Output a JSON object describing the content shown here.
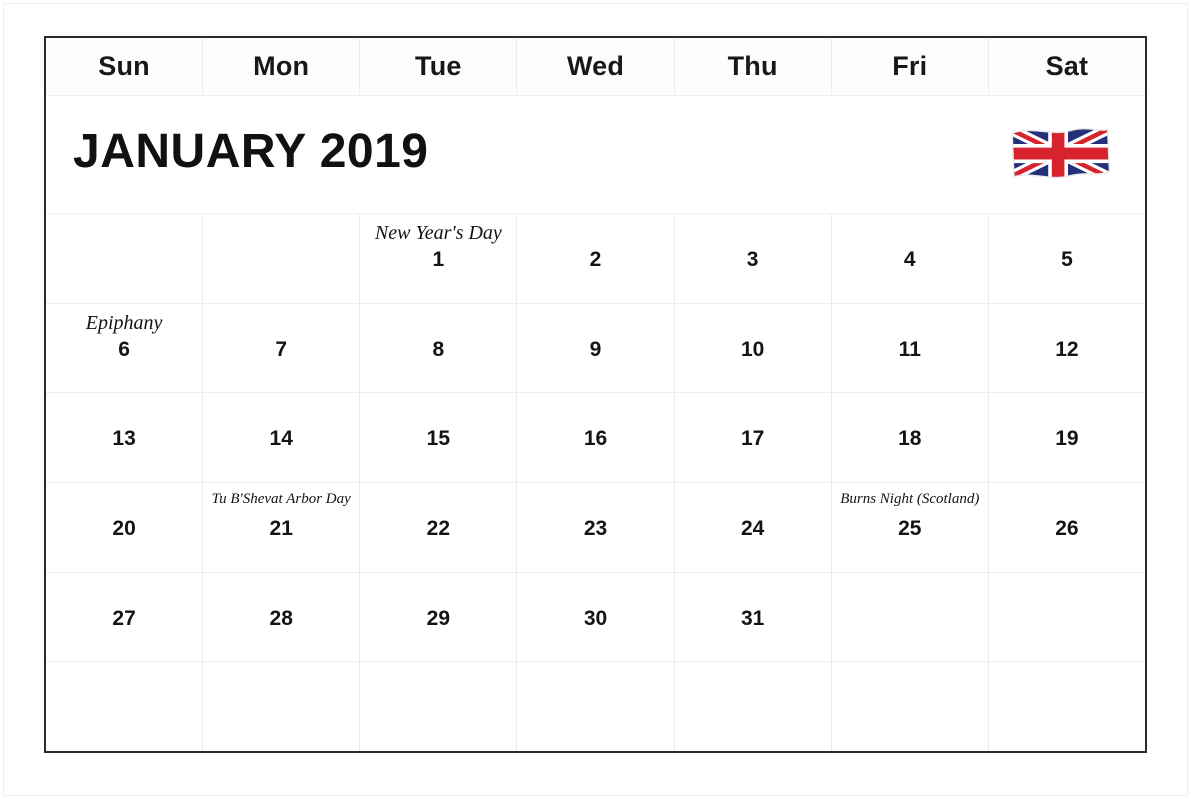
{
  "calendar": {
    "title": "JANUARY 2019",
    "flag_icon": "union-jack-flag-icon",
    "flag_label": "United Kingdom flag",
    "weekdays": [
      "Sun",
      "Mon",
      "Tue",
      "Wed",
      "Thu",
      "Fri",
      "Sat"
    ],
    "colors": {
      "frame": "#2b2b2b",
      "gridline": "#ededed",
      "text": "#141414",
      "page_border": "#f0f0f0",
      "flag_red": "#d7232e",
      "flag_blue": "#26307a",
      "flag_white": "#ffffff"
    },
    "weeks": [
      [
        {
          "date": "",
          "event": ""
        },
        {
          "date": "",
          "event": ""
        },
        {
          "date": "1",
          "event": "New Year's Day",
          "event_size": "lg"
        },
        {
          "date": "2",
          "event": ""
        },
        {
          "date": "3",
          "event": ""
        },
        {
          "date": "4",
          "event": ""
        },
        {
          "date": "5",
          "event": ""
        }
      ],
      [
        {
          "date": "6",
          "event": "Epiphany",
          "event_size": "lg"
        },
        {
          "date": "7",
          "event": ""
        },
        {
          "date": "8",
          "event": ""
        },
        {
          "date": "9",
          "event": ""
        },
        {
          "date": "10",
          "event": ""
        },
        {
          "date": "11",
          "event": ""
        },
        {
          "date": "12",
          "event": ""
        }
      ],
      [
        {
          "date": "13",
          "event": ""
        },
        {
          "date": "14",
          "event": ""
        },
        {
          "date": "15",
          "event": ""
        },
        {
          "date": "16",
          "event": ""
        },
        {
          "date": "17",
          "event": ""
        },
        {
          "date": "18",
          "event": ""
        },
        {
          "date": "19",
          "event": ""
        }
      ],
      [
        {
          "date": "20",
          "event": ""
        },
        {
          "date": "21",
          "event": "Tu B'Shevat Arbor Day",
          "event_size": "sm"
        },
        {
          "date": "22",
          "event": ""
        },
        {
          "date": "23",
          "event": ""
        },
        {
          "date": "24",
          "event": ""
        },
        {
          "date": "25",
          "event": "Burns Night (Scotland)",
          "event_size": "sm"
        },
        {
          "date": "26",
          "event": ""
        }
      ],
      [
        {
          "date": "27",
          "event": ""
        },
        {
          "date": "28",
          "event": ""
        },
        {
          "date": "29",
          "event": ""
        },
        {
          "date": "30",
          "event": ""
        },
        {
          "date": "31",
          "event": ""
        },
        {
          "date": "",
          "event": ""
        },
        {
          "date": "",
          "event": ""
        }
      ],
      [
        {
          "date": "",
          "event": ""
        },
        {
          "date": "",
          "event": ""
        },
        {
          "date": "",
          "event": ""
        },
        {
          "date": "",
          "event": ""
        },
        {
          "date": "",
          "event": ""
        },
        {
          "date": "",
          "event": ""
        },
        {
          "date": "",
          "event": ""
        }
      ]
    ]
  }
}
